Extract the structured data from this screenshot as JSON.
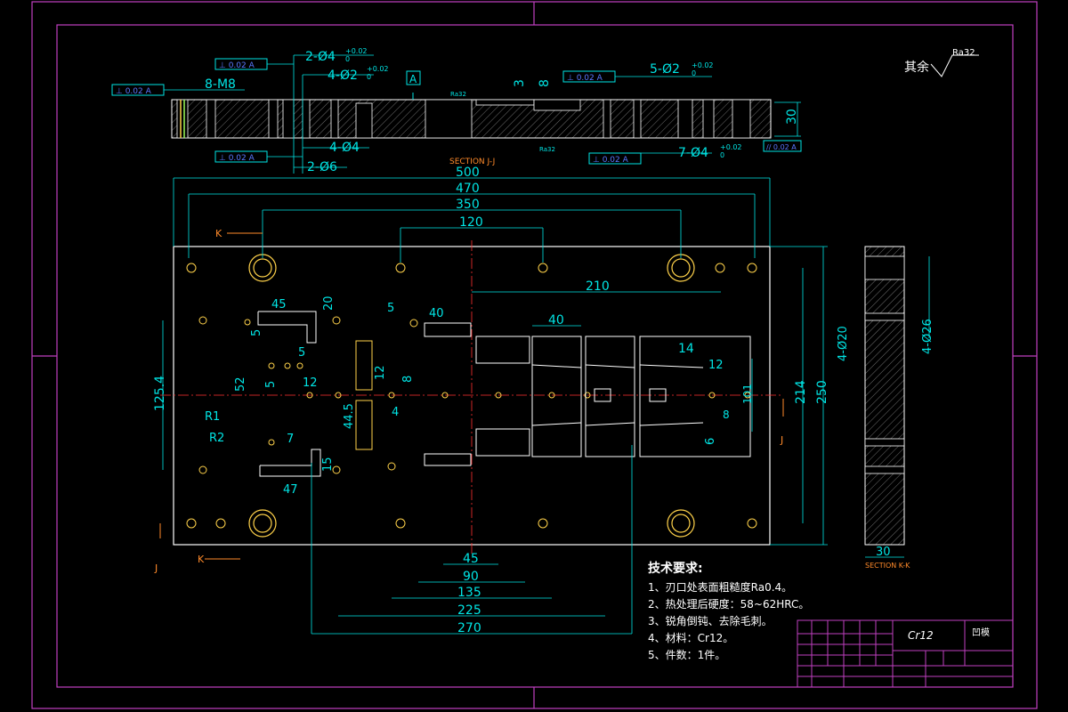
{
  "section_labels": {
    "top": "SECTION J-J",
    "side": "SECTION K-K"
  },
  "surface_note": {
    "label": "其余",
    "value": "Ra32"
  },
  "top_view": {
    "tolerances": [
      {
        "frame": "⊥ 0.02 A"
      },
      {
        "frame": "⊥ 0.02 A"
      },
      {
        "frame": "⊥ 0.02 A"
      },
      {
        "frame": "⊥ 0.02 A"
      },
      {
        "frame": "⊥ 0.02 A"
      },
      {
        "frame": "// 0.02 A"
      }
    ],
    "datum": "A",
    "callouts": {
      "thread": "8-M8",
      "hole_2_d4": "2-Ø4",
      "hole_4_d2": "4-Ø2",
      "hole_4_d4": "4-Ø4",
      "hole_2_d6": "2-Ø6",
      "hole_5_d2": "5-Ø2",
      "hole_7_d4": "7-Ø4",
      "tol_up": "+0.02",
      "tol_low": "0",
      "dim_3": "3",
      "dim_8": "8",
      "thickness": "30",
      "ra_1": "Ra32",
      "ra_2": "Ra32"
    }
  },
  "plan_view": {
    "h_dims": [
      "500",
      "470",
      "350",
      "120",
      "210",
      "40",
      "14",
      "45",
      "90",
      "135",
      "225",
      "270"
    ],
    "v_dims": [
      "250",
      "214",
      "125.4",
      "101",
      "8"
    ],
    "side_dims": {
      "hole_a": "4-Ø20",
      "hole_b": "4-Ø26",
      "thick": "30"
    },
    "small_dims": {
      "d45": "45",
      "d20": "20",
      "d5a": "5",
      "d5b": "5",
      "d40": "40",
      "d5c": "5",
      "d12a": "12",
      "d12b": "12",
      "d12c": "12",
      "d8": "8",
      "d5d": "5",
      "d47": "47",
      "d52": "52",
      "d7": "7",
      "d445": "44.5",
      "d4": "4",
      "d6": "6",
      "r1": "R1",
      "r2": "R2",
      "d15": "15"
    },
    "cuts": {
      "k_top": "K",
      "k_bottom": "K",
      "j_left": "J",
      "j_right": "J"
    }
  },
  "tech_requirements": {
    "title": "技术要求:",
    "items": [
      "1、刃口处表面粗糙度Ra0.4。",
      "2、热处理后硬度：58~62HRC。",
      "3、锐角倒钝、去除毛刺。",
      "4、材料：Cr12。",
      "5、件数：1件。"
    ]
  },
  "title_block": {
    "material": "Cr12",
    "part_name": "凹模"
  },
  "colors": {
    "border": "#c040c0",
    "dim": "#00e5e5",
    "part": "#ffffff",
    "center": "#ff3030",
    "hole": "#ffd24a",
    "note": "#ff8a2a"
  }
}
